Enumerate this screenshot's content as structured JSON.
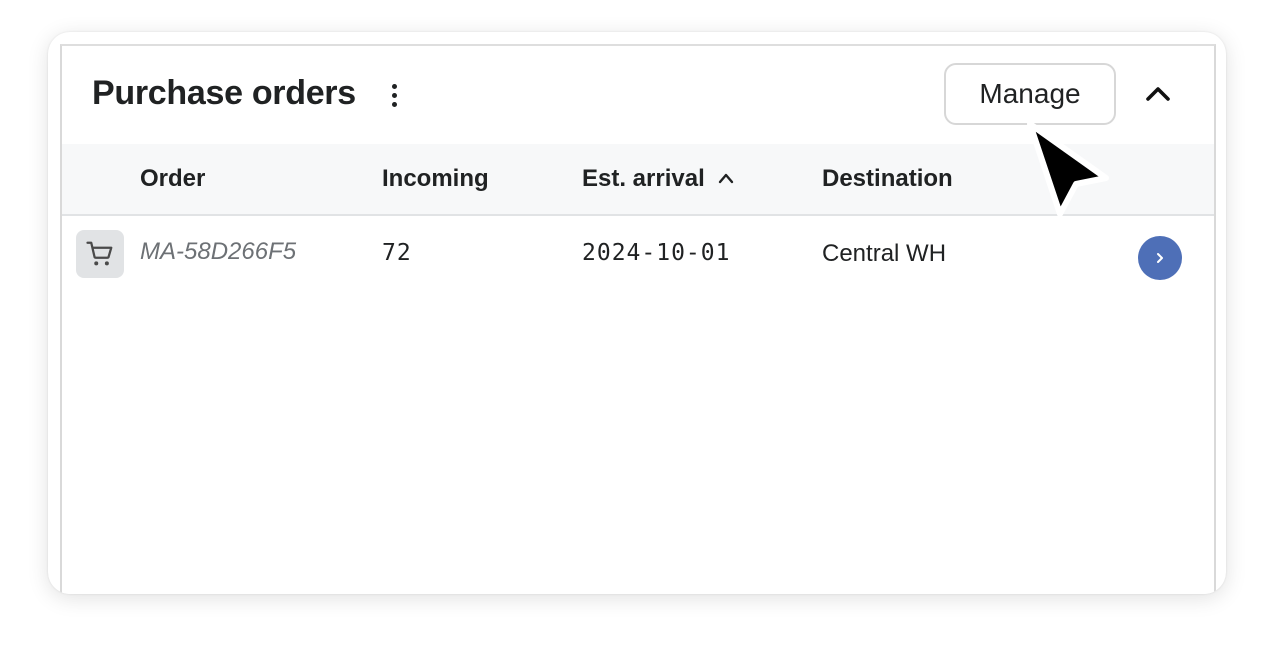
{
  "card": {
    "title": "Purchase orders",
    "manage_label": "Manage"
  },
  "table": {
    "columns": [
      "Order",
      "Incoming",
      "Est. arrival",
      "Destination"
    ],
    "sorted_column": "Est. arrival",
    "sort_direction": "ascending",
    "rows": [
      {
        "order": "MA-58D266F5",
        "incoming": "72",
        "est_arrival": "2024-10-01",
        "destination": "Central WH"
      }
    ]
  },
  "icons": {
    "more": "more-vertical-icon",
    "collapse": "chevron-up-icon",
    "sort": "sort-ascending-icon",
    "row_thumb": "shopping-cart-icon",
    "row_action": "chevron-right-icon",
    "pointer": "mouse-cursor-icon"
  },
  "colors": {
    "action_button": "#4e6fb7",
    "header_background": "#f7f8f9",
    "thumbnail_background": "#e1e3e5",
    "text_primary": "#202223",
    "text_muted": "#6d7175"
  }
}
